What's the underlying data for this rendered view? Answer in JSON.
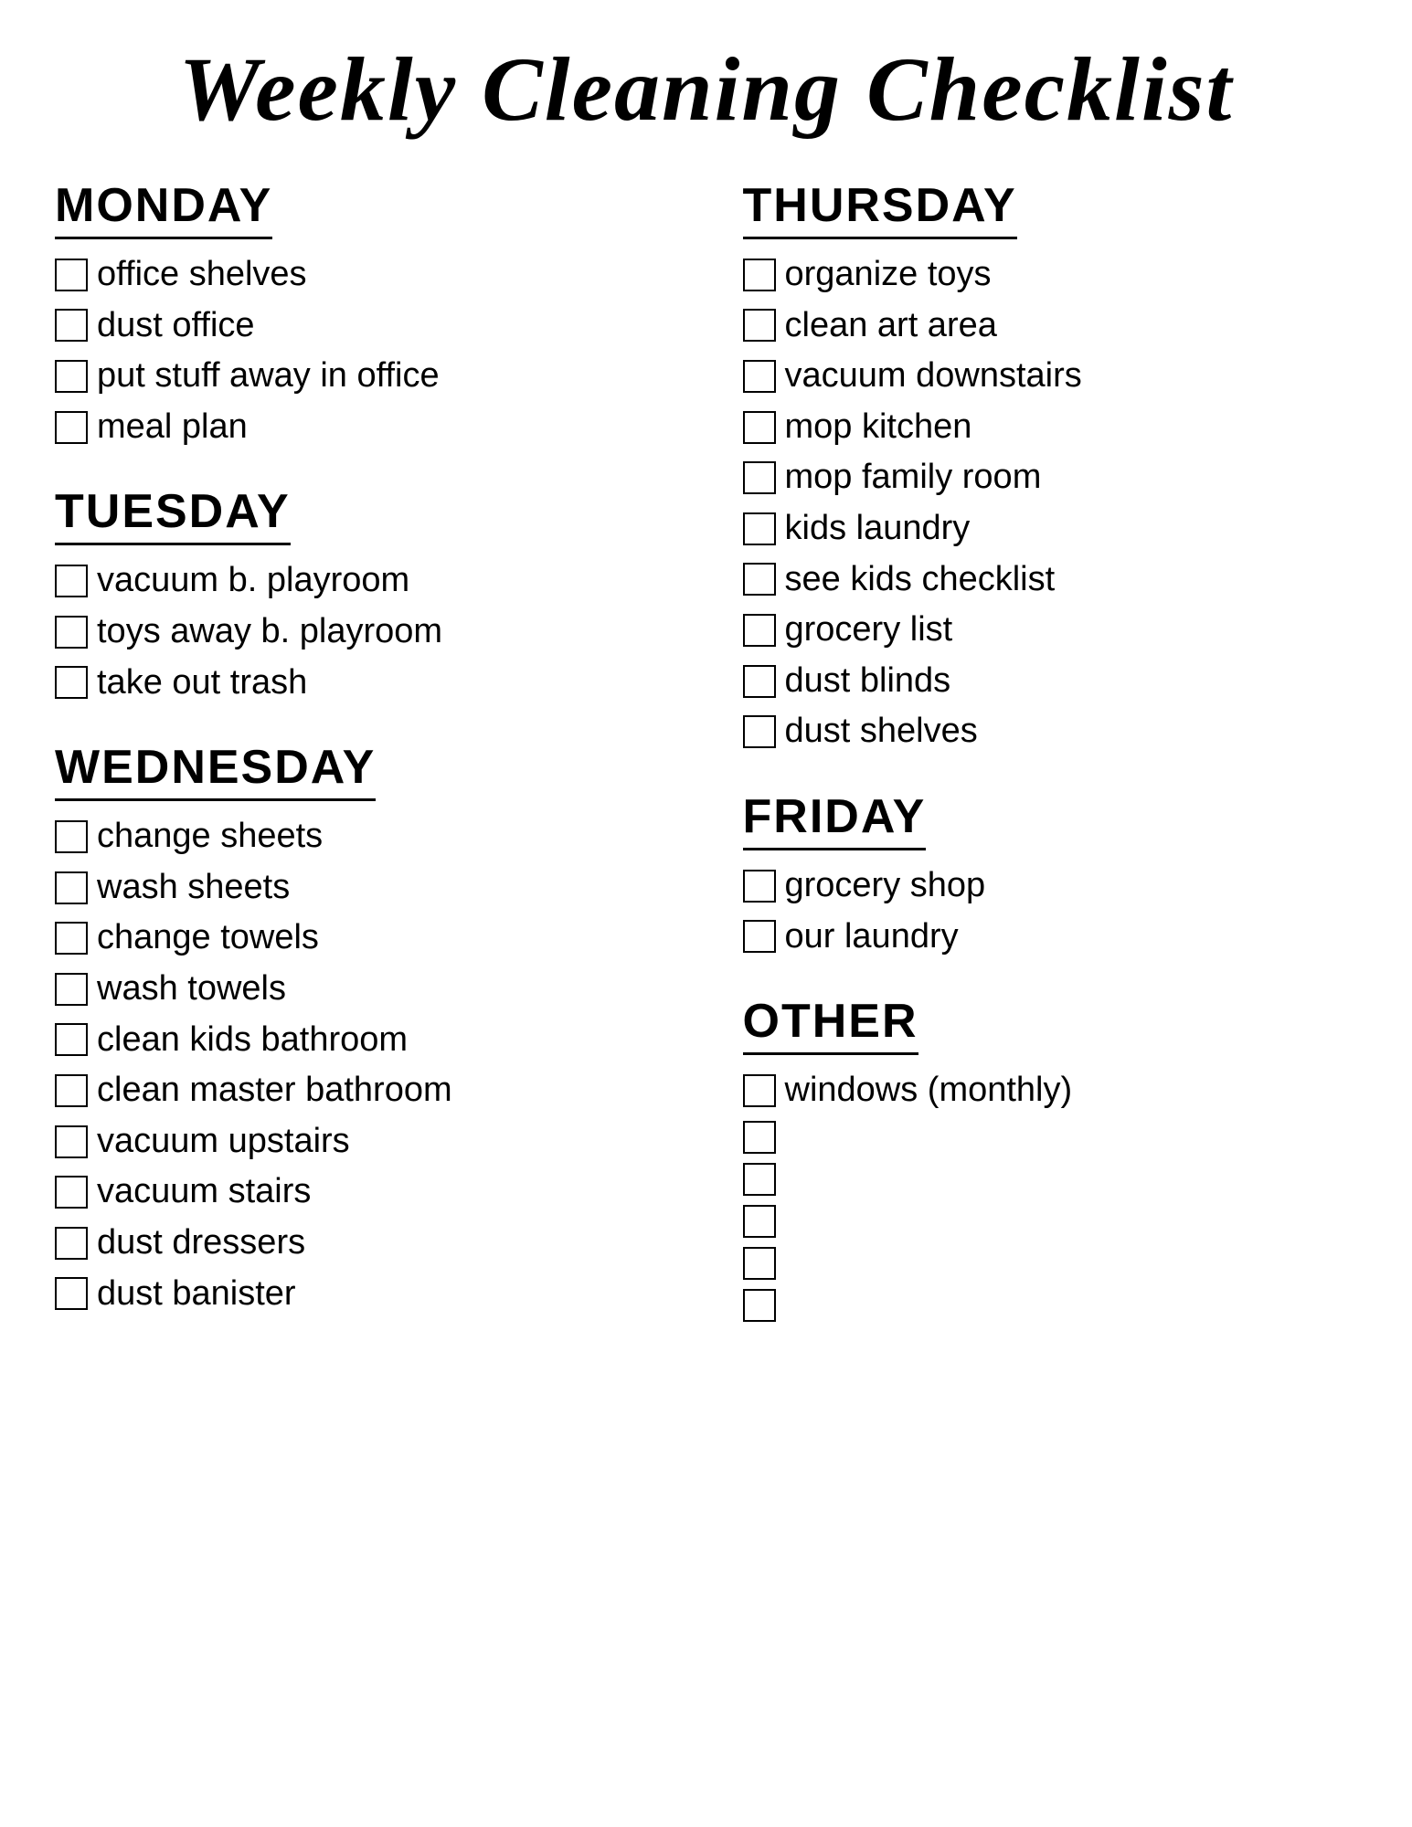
{
  "title": "Weekly Cleaning Checklist",
  "columns": {
    "left": {
      "sections": [
        {
          "id": "monday",
          "heading": "MONDAY",
          "items": [
            "office shelves",
            "dust office",
            "put stuff away in office",
            "meal plan"
          ]
        },
        {
          "id": "tuesday",
          "heading": "TUESDAY",
          "items": [
            "vacuum b. playroom",
            "toys away b. playroom",
            "take out trash"
          ]
        },
        {
          "id": "wednesday",
          "heading": "WEDNESDAY",
          "items": [
            "change sheets",
            "wash sheets",
            "change towels",
            "wash towels",
            "clean kids bathroom",
            "clean master bathroom",
            "vacuum upstairs",
            "vacuum stairs",
            "dust dressers",
            "dust banister"
          ]
        }
      ]
    },
    "right": {
      "sections": [
        {
          "id": "thursday",
          "heading": "THURSDAY",
          "items": [
            "organize toys",
            "clean art area",
            "vacuum downstairs",
            "mop kitchen",
            "mop family room",
            "kids laundry",
            "see kids checklist",
            "grocery list",
            "dust blinds",
            "dust shelves"
          ]
        },
        {
          "id": "friday",
          "heading": "FRIDAY",
          "items": [
            "grocery shop",
            "our laundry"
          ]
        },
        {
          "id": "other",
          "heading": "OTHER",
          "items": [
            "windows (monthly)",
            "",
            "",
            "",
            "",
            ""
          ]
        }
      ]
    }
  }
}
